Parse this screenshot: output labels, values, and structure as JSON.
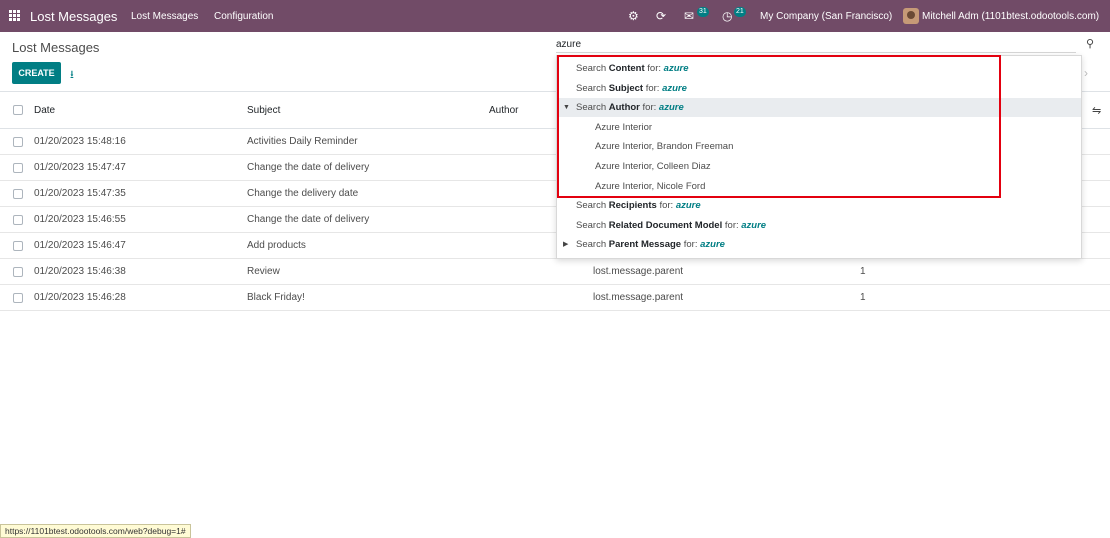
{
  "navbar": {
    "app_title": "Lost Messages",
    "menu": [
      "Lost Messages",
      "Configuration"
    ],
    "icons": [
      "apps-grid-icon",
      "bug-icon",
      "refresh-icon",
      "chat-icon",
      "clock-icon"
    ],
    "chat_count": "31",
    "activity_count": "21",
    "company": "My Company (San Francisco)",
    "user": "Mitchell Adm (1101btest.odootools.com)"
  },
  "control_panel": {
    "title": "Lost Messages",
    "create_label": "CREATE",
    "search_value": "azure"
  },
  "table": {
    "columns": [
      "Date",
      "Subject",
      "Author"
    ],
    "rows": [
      {
        "date": "01/20/2023 15:48:16",
        "subject": "Activities Daily Reminder",
        "model": "",
        "count": ""
      },
      {
        "date": "01/20/2023 15:47:47",
        "subject": "Change the date of delivery",
        "model": "",
        "count": ""
      },
      {
        "date": "01/20/2023 15:47:35",
        "subject": "Change the delivery date",
        "model": "",
        "count": ""
      },
      {
        "date": "01/20/2023 15:46:55",
        "subject": "Change the date of delivery",
        "model": "",
        "count": ""
      },
      {
        "date": "01/20/2023 15:46:47",
        "subject": "Add products",
        "model": "",
        "count": ""
      },
      {
        "date": "01/20/2023 15:46:38",
        "subject": "Review",
        "model": "lost.message.parent",
        "count": "1"
      },
      {
        "date": "01/20/2023 15:46:28",
        "subject": "Black Friday!",
        "model": "lost.message.parent",
        "count": "1"
      }
    ]
  },
  "dropdown": {
    "query": "azure",
    "for_label": "for:",
    "search_word": "Search",
    "items": [
      {
        "field": "Content"
      },
      {
        "field": "Subject"
      },
      {
        "field": "Author"
      },
      {
        "field": "Recipients"
      },
      {
        "field": "Related Document Model"
      },
      {
        "field": "Parent Message"
      }
    ],
    "author_suggestions": [
      "Azure Interior",
      "Azure Interior, Brandon Freeman",
      "Azure Interior, Colleen Diaz",
      "Azure Interior, Nicole Ford"
    ]
  },
  "status_url": "https://1101btest.odootools.com/web?debug=1#",
  "colors": {
    "navbar": "#714b67",
    "primary": "#017e84",
    "highlight_border": "#e3000f"
  }
}
